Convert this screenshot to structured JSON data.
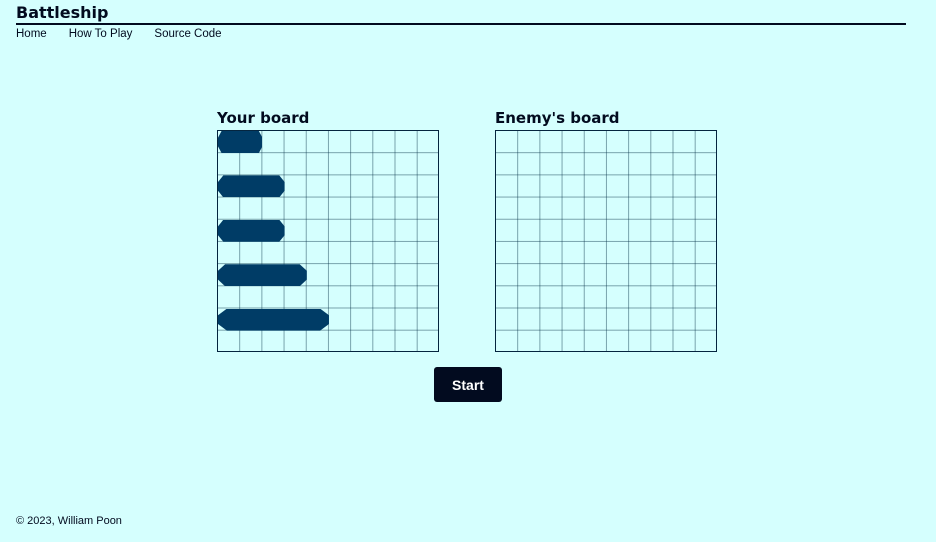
{
  "header": {
    "title": "Battleship",
    "nav": [
      {
        "label": "Home"
      },
      {
        "label": "How To Play"
      },
      {
        "label": "Source Code"
      }
    ]
  },
  "boards": {
    "player_title": "Your board",
    "enemy_title": "Enemy's board",
    "grid_size": 10,
    "player_ships": [
      {
        "row": 0,
        "col": 0,
        "length": 2
      },
      {
        "row": 2,
        "col": 0,
        "length": 3
      },
      {
        "row": 4,
        "col": 0,
        "length": 3
      },
      {
        "row": 6,
        "col": 0,
        "length": 4
      },
      {
        "row": 8,
        "col": 0,
        "length": 5
      }
    ]
  },
  "actions": {
    "start_label": "Start"
  },
  "footer": {
    "text": "© 2023, William Poon"
  },
  "colors": {
    "background": "#d5fffe",
    "ship": "#003c66",
    "dark": "#020b1f"
  }
}
